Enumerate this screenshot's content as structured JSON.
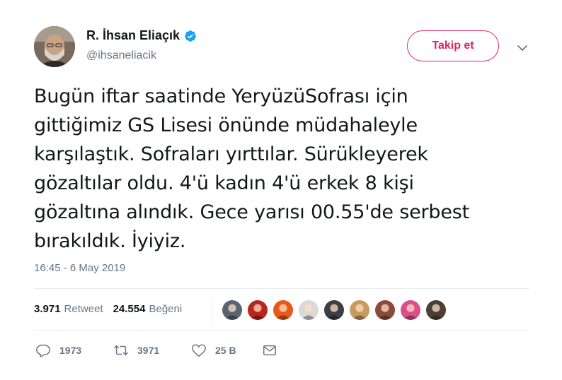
{
  "author": {
    "display_name": "R. İhsan Eliaçık",
    "handle": "@ihsaneliacik",
    "verified": true,
    "avatar_icon": "profile-photo"
  },
  "follow_button": {
    "label": "Takip et",
    "color": "#e0245e"
  },
  "tweet": {
    "text": "Bugün iftar saatinde YeryüzüSofrası için\ngittiğimiz GS Lisesi önünde müdahaleyle\nkarşılaştık. Sofraları yırttılar. Sürükleyerek\ngözaltılar oldu. 4'ü kadın 4'ü erkek 8 kişi\ngözaltına alındık. Gece yarısı 00.55'de serbest\nbırakıldık. İyiyiz.",
    "timestamp": "16:45 - 6 May 2019"
  },
  "stats": {
    "retweets": {
      "count": "3.971",
      "label": "Retweet"
    },
    "likes": {
      "count": "24.554",
      "label": "Beğeni"
    }
  },
  "likers": [
    {
      "color": "#5a6470"
    },
    {
      "color": "#b8261e"
    },
    {
      "color": "#e8571b"
    },
    {
      "color": "#d9d9d9"
    },
    {
      "color": "#3a3f47"
    },
    {
      "color": "#c59b62"
    },
    {
      "color": "#8c4a3a"
    },
    {
      "color": "#d94f8c"
    },
    {
      "color": "#4a3e36"
    }
  ],
  "actions": {
    "reply": {
      "icon": "reply-icon",
      "count": "1973"
    },
    "retweet": {
      "icon": "retweet-icon",
      "count": "3971"
    },
    "like": {
      "icon": "heart-icon",
      "count": "25 B"
    },
    "message": {
      "icon": "envelope-icon"
    }
  }
}
